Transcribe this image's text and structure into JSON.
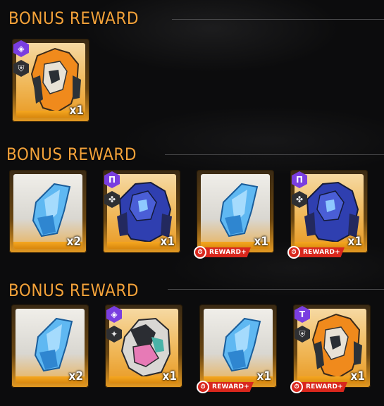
{
  "sections": [
    {
      "title": "BONUS REWARD",
      "items": [
        {
          "type": "mech-orange",
          "qty": "x1",
          "rank_icon": "diamond-icon",
          "class_icon": "shield-icon",
          "bonus_tag": null
        }
      ]
    },
    {
      "title": "BONUS REWARD",
      "items": [
        {
          "type": "crystal",
          "qty": "x2",
          "rank_icon": null,
          "class_icon": null,
          "bonus_tag": null
        },
        {
          "type": "mech-blue",
          "qty": "x1",
          "rank_icon": "rank-n-icon",
          "class_icon": "emblem-icon",
          "bonus_tag": null
        },
        {
          "type": "crystal",
          "qty": "x1",
          "rank_icon": null,
          "class_icon": null,
          "bonus_tag": "REWARD+"
        },
        {
          "type": "mech-blue",
          "qty": "x1",
          "rank_icon": "rank-n-icon",
          "class_icon": "emblem-icon",
          "bonus_tag": "REWARD+"
        }
      ]
    },
    {
      "title": "BONUS REWARD",
      "items": [
        {
          "type": "crystal",
          "qty": "x2",
          "rank_icon": null,
          "class_icon": null,
          "bonus_tag": null
        },
        {
          "type": "mech-pink",
          "qty": "x1",
          "rank_icon": "diamond-icon",
          "class_icon": "star-icon",
          "bonus_tag": null
        },
        {
          "type": "crystal",
          "qty": "x1",
          "rank_icon": null,
          "class_icon": null,
          "bonus_tag": "REWARD+"
        },
        {
          "type": "mech-orange",
          "qty": "x1",
          "rank_icon": "rank-t-icon",
          "class_icon": "shield-icon",
          "bonus_tag": "REWARD+"
        }
      ]
    }
  ],
  "colors": {
    "title": "#f3a23a",
    "rank": "#7a3ee0",
    "bonus": "#d9271d",
    "card": "#e99a24"
  }
}
